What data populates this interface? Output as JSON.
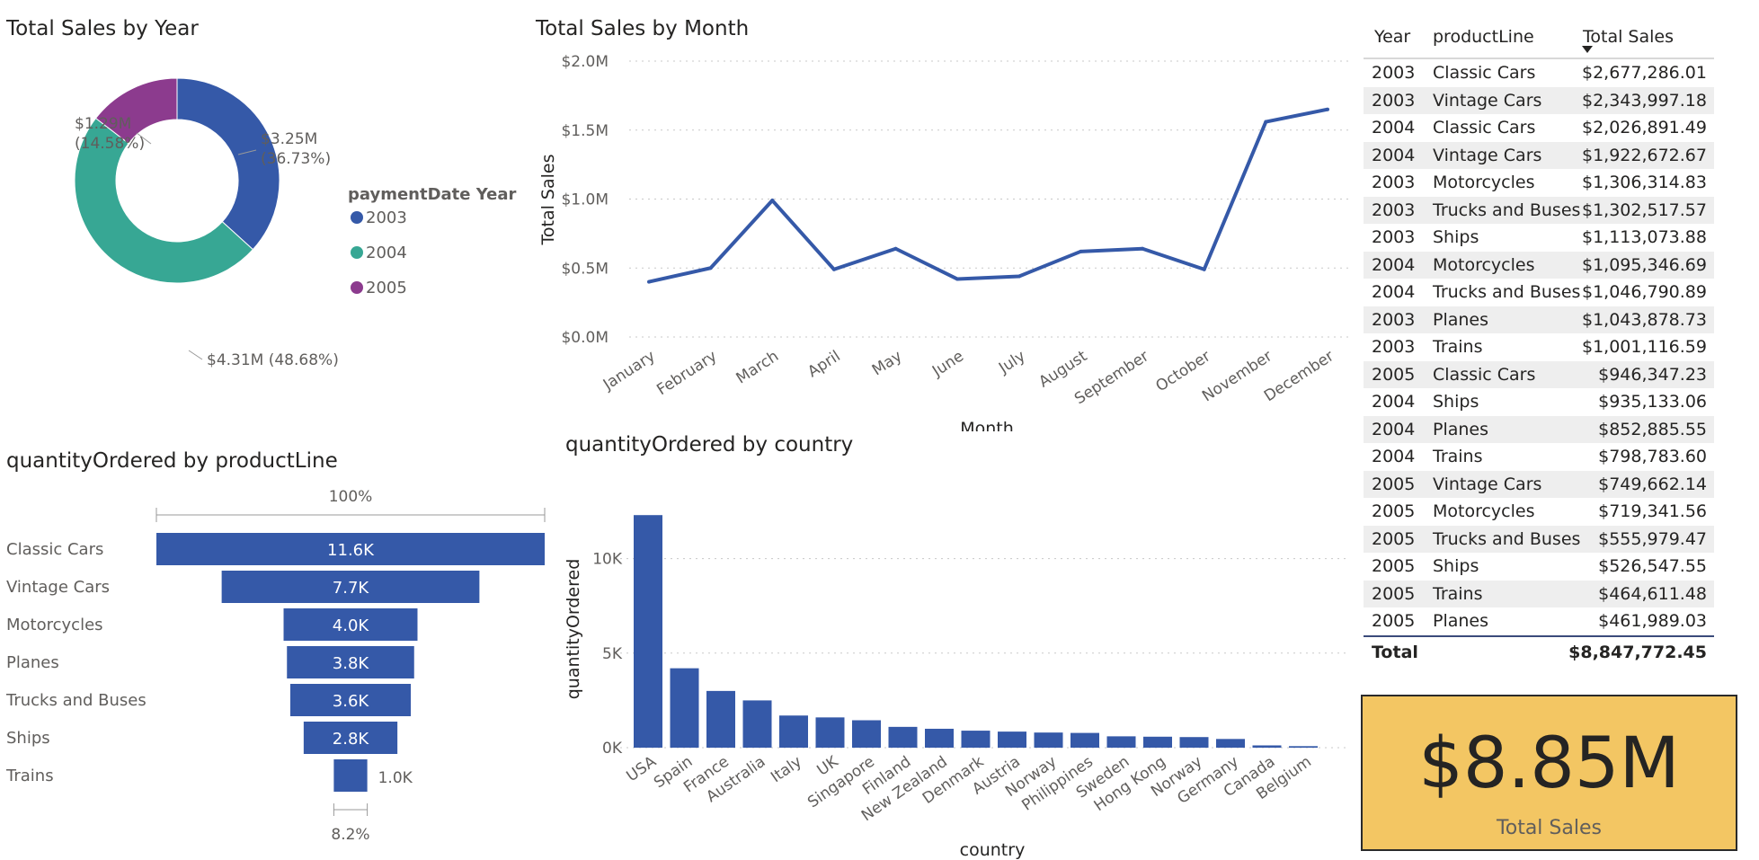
{
  "donut": {
    "title": "Total Sales by Year",
    "legend_title": "paymentDate Year",
    "chart_data": {
      "type": "pie",
      "hole": true,
      "slices": [
        {
          "label": "2003",
          "value": 3.25,
          "percent": 36.73,
          "data_label": "$3.25M",
          "pct_label": "(36.73%)",
          "color": "#3559a8"
        },
        {
          "label": "2004",
          "value": 4.31,
          "percent": 48.68,
          "data_label": "$4.31M (48.68%)",
          "pct_label": "",
          "color": "#37a794"
        },
        {
          "label": "2005",
          "value": 1.29,
          "percent": 14.58,
          "data_label": "$1.29M",
          "pct_label": "(14.58%)",
          "color": "#8c3b8e"
        }
      ]
    }
  },
  "line": {
    "title": "Total Sales by Month",
    "chart_data": {
      "type": "line",
      "categories": [
        "January",
        "February",
        "March",
        "April",
        "May",
        "June",
        "July",
        "August",
        "September",
        "October",
        "November",
        "December"
      ],
      "series": [
        {
          "values": [
            0.4,
            0.5,
            0.99,
            0.49,
            0.64,
            0.42,
            0.44,
            0.62,
            0.64,
            0.49,
            1.56,
            1.65
          ],
          "color": "#3559a8"
        }
      ],
      "ylim": [
        0,
        2.0
      ],
      "yticks": [
        "$0.0M",
        "$0.5M",
        "$1.0M",
        "$1.5M",
        "$2.0M"
      ],
      "ylabel": "Total Sales",
      "xlabel": "Month",
      "grid": true
    }
  },
  "funnel": {
    "title": "quantityOrdered by productLine",
    "top_label": "100%",
    "bottom_label": "8.2%",
    "chart_data": {
      "type": "bar",
      "orientation": "funnel",
      "categories": [
        "Classic Cars",
        "Vintage Cars",
        "Motorcycles",
        "Planes",
        "Trucks and Buses",
        "Ships",
        "Trains"
      ],
      "values": [
        11.6,
        7.7,
        4.0,
        3.8,
        3.6,
        2.8,
        1.0
      ],
      "labels": [
        "11.6K",
        "7.7K",
        "4.0K",
        "3.8K",
        "3.6K",
        "2.8K",
        "1.0K"
      ],
      "color": "#3559a8"
    }
  },
  "bars": {
    "title": "quantityOrdered by country",
    "chart_data": {
      "type": "bar",
      "categories": [
        "USA",
        "Spain",
        "France",
        "Australia",
        "Italy",
        "UK",
        "Singapore",
        "Finland",
        "New Zealand",
        "Denmark",
        "Austria",
        "Norway",
        "Philippines",
        "Sweden",
        "Hong Kong",
        "Norway",
        "Germany",
        "Canada",
        "Belgium"
      ],
      "values": [
        12300,
        4200,
        3000,
        2500,
        1700,
        1600,
        1450,
        1100,
        1000,
        900,
        850,
        800,
        780,
        600,
        580,
        560,
        460,
        120,
        80
      ],
      "ylim": [
        0,
        12500
      ],
      "yticks": [
        "0K",
        "5K",
        "10K"
      ],
      "ylabel": "quantityOrdered",
      "xlabel": "country",
      "color": "#3559a8",
      "grid": true
    }
  },
  "table": {
    "headers": {
      "year": "Year",
      "line": "productLine",
      "sales": "Total Sales"
    },
    "rows": [
      {
        "year": "2003",
        "line": "Classic Cars",
        "sales": "$2,677,286.01"
      },
      {
        "year": "2003",
        "line": "Vintage Cars",
        "sales": "$2,343,997.18"
      },
      {
        "year": "2004",
        "line": "Classic Cars",
        "sales": "$2,026,891.49"
      },
      {
        "year": "2004",
        "line": "Vintage Cars",
        "sales": "$1,922,672.67"
      },
      {
        "year": "2003",
        "line": "Motorcycles",
        "sales": "$1,306,314.83"
      },
      {
        "year": "2003",
        "line": "Trucks and Buses",
        "sales": "$1,302,517.57"
      },
      {
        "year": "2003",
        "line": "Ships",
        "sales": "$1,113,073.88"
      },
      {
        "year": "2004",
        "line": "Motorcycles",
        "sales": "$1,095,346.69"
      },
      {
        "year": "2004",
        "line": "Trucks and Buses",
        "sales": "$1,046,790.89"
      },
      {
        "year": "2003",
        "line": "Planes",
        "sales": "$1,043,878.73"
      },
      {
        "year": "2003",
        "line": "Trains",
        "sales": "$1,001,116.59"
      },
      {
        "year": "2005",
        "line": "Classic Cars",
        "sales": "$946,347.23"
      },
      {
        "year": "2004",
        "line": "Ships",
        "sales": "$935,133.06"
      },
      {
        "year": "2004",
        "line": "Planes",
        "sales": "$852,885.55"
      },
      {
        "year": "2004",
        "line": "Trains",
        "sales": "$798,783.60"
      },
      {
        "year": "2005",
        "line": "Vintage Cars",
        "sales": "$749,662.14"
      },
      {
        "year": "2005",
        "line": "Motorcycles",
        "sales": "$719,341.56"
      },
      {
        "year": "2005",
        "line": "Trucks and Buses",
        "sales": "$555,979.47"
      },
      {
        "year": "2005",
        "line": "Ships",
        "sales": "$526,547.55"
      },
      {
        "year": "2005",
        "line": "Trains",
        "sales": "$464,611.48"
      },
      {
        "year": "2005",
        "line": "Planes",
        "sales": "$461,989.03"
      }
    ],
    "total_label": "Total",
    "total_value": "$8,847,772.45"
  },
  "card": {
    "value": "$8.85M",
    "label": "Total Sales",
    "background": "#f3c663"
  }
}
